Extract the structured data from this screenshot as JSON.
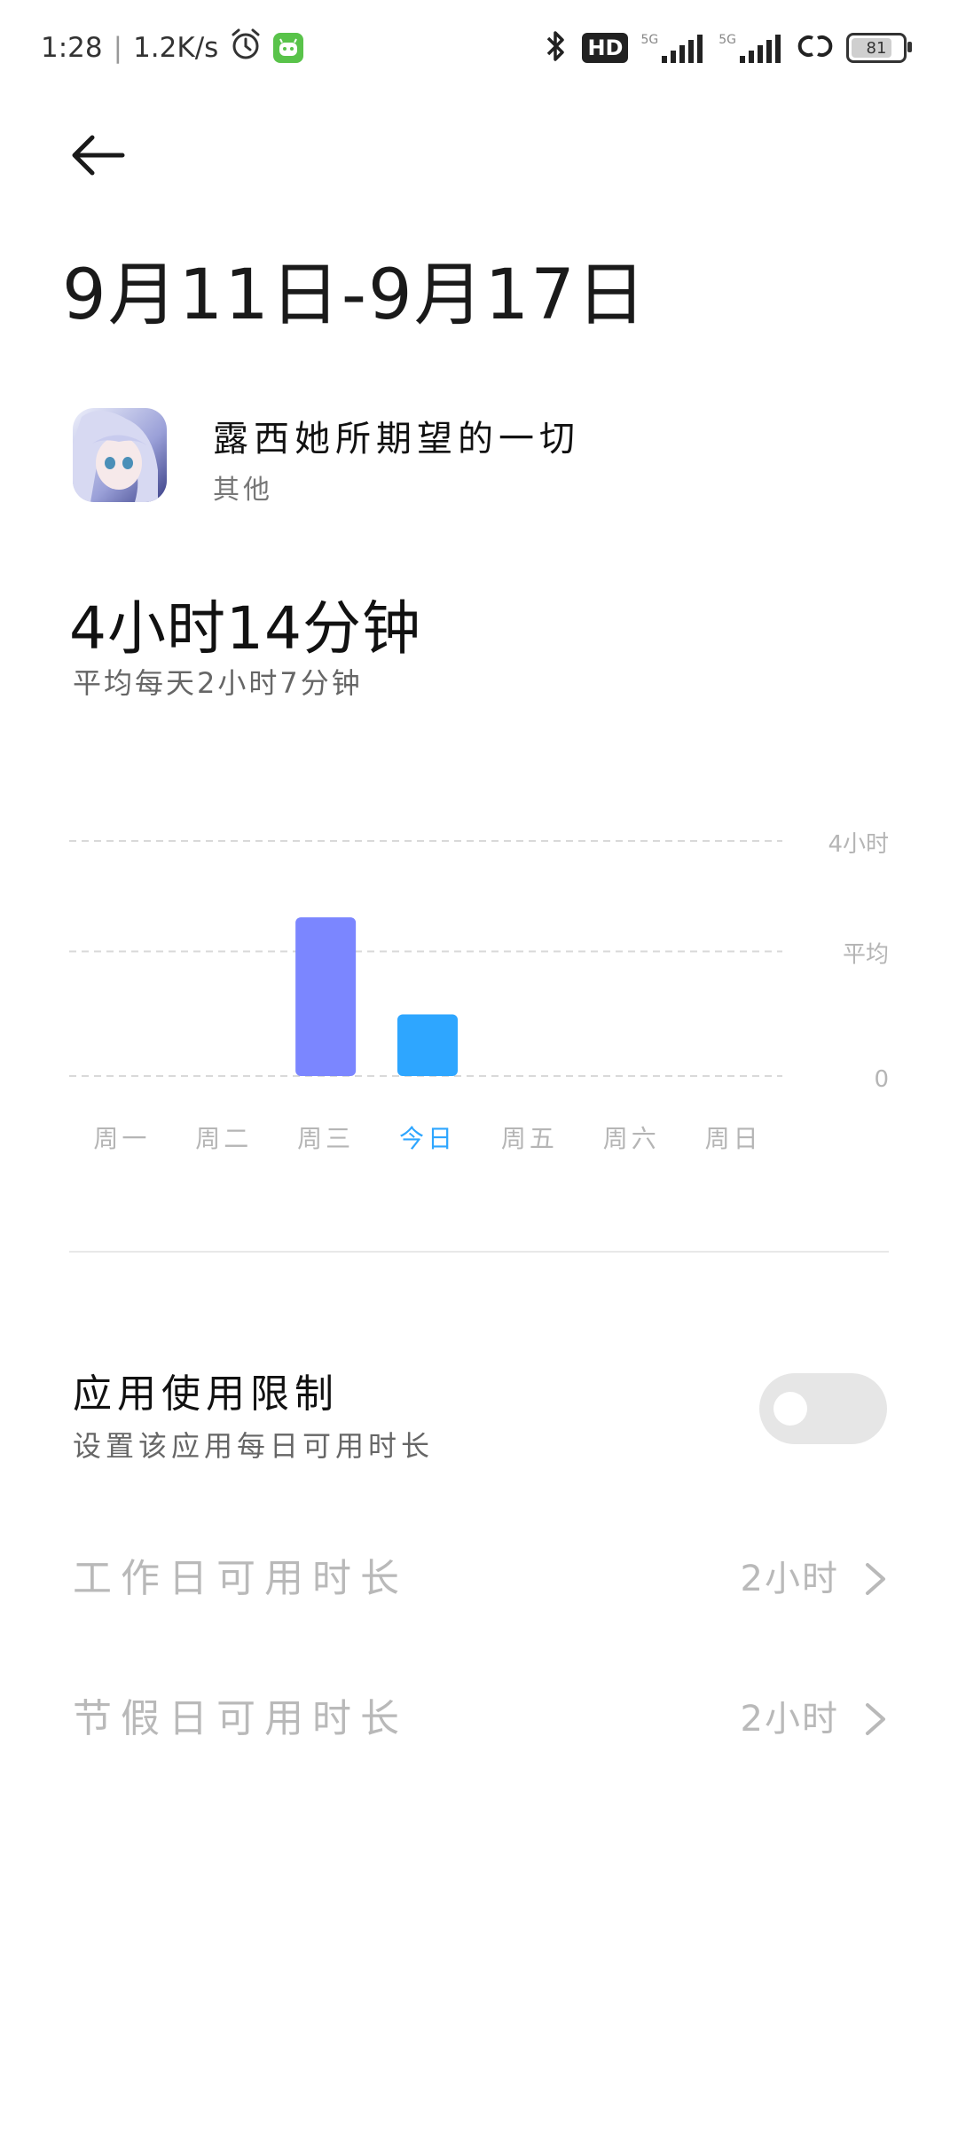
{
  "status_bar": {
    "time": "1:28",
    "network_speed": "1.2K/s",
    "network_type": "5G",
    "hd_label": "HD",
    "battery_percent": "81",
    "battery_level": 0.81,
    "icons": [
      "alarm-icon",
      "app-notification-icon",
      "bluetooth-icon",
      "hd-icon",
      "signal-icon",
      "signal-icon",
      "link-icon",
      "battery-icon"
    ]
  },
  "header": {
    "title": "9月11日-9月17日"
  },
  "app": {
    "name": "露西她所期望的一切",
    "category": "其他"
  },
  "usage": {
    "total": "4小时14分钟",
    "average": "平均每天2小时7分钟"
  },
  "chart_data": {
    "type": "bar",
    "categories": [
      "周一",
      "周二",
      "周三",
      "今日",
      "周五",
      "周六",
      "周日"
    ],
    "values": [
      0,
      0,
      2.7,
      1.05,
      0,
      0,
      0
    ],
    "highlight_index": 3,
    "colors": {
      "default_bar": "#7b86ff",
      "highlight_bar": "#2ea6ff",
      "highlight_label": "#2ea6ff",
      "label": "#b5b5b5",
      "gridline": "#d9d9d9"
    },
    "ylim": [
      0,
      4
    ],
    "average": 2.12,
    "reference_lines": [
      {
        "label": "4小时",
        "value": 4
      },
      {
        "label": "平均",
        "value": 2.12
      },
      {
        "label": "0",
        "value": 0
      }
    ],
    "grid": "dashed horizontal"
  },
  "limit": {
    "title": "应用使用限制",
    "description": "设置该应用每日可用时长",
    "enabled": false
  },
  "settings": [
    {
      "label": "工作日可用时长",
      "value": "2小时"
    },
    {
      "label": "节假日可用时长",
      "value": "2小时"
    }
  ]
}
